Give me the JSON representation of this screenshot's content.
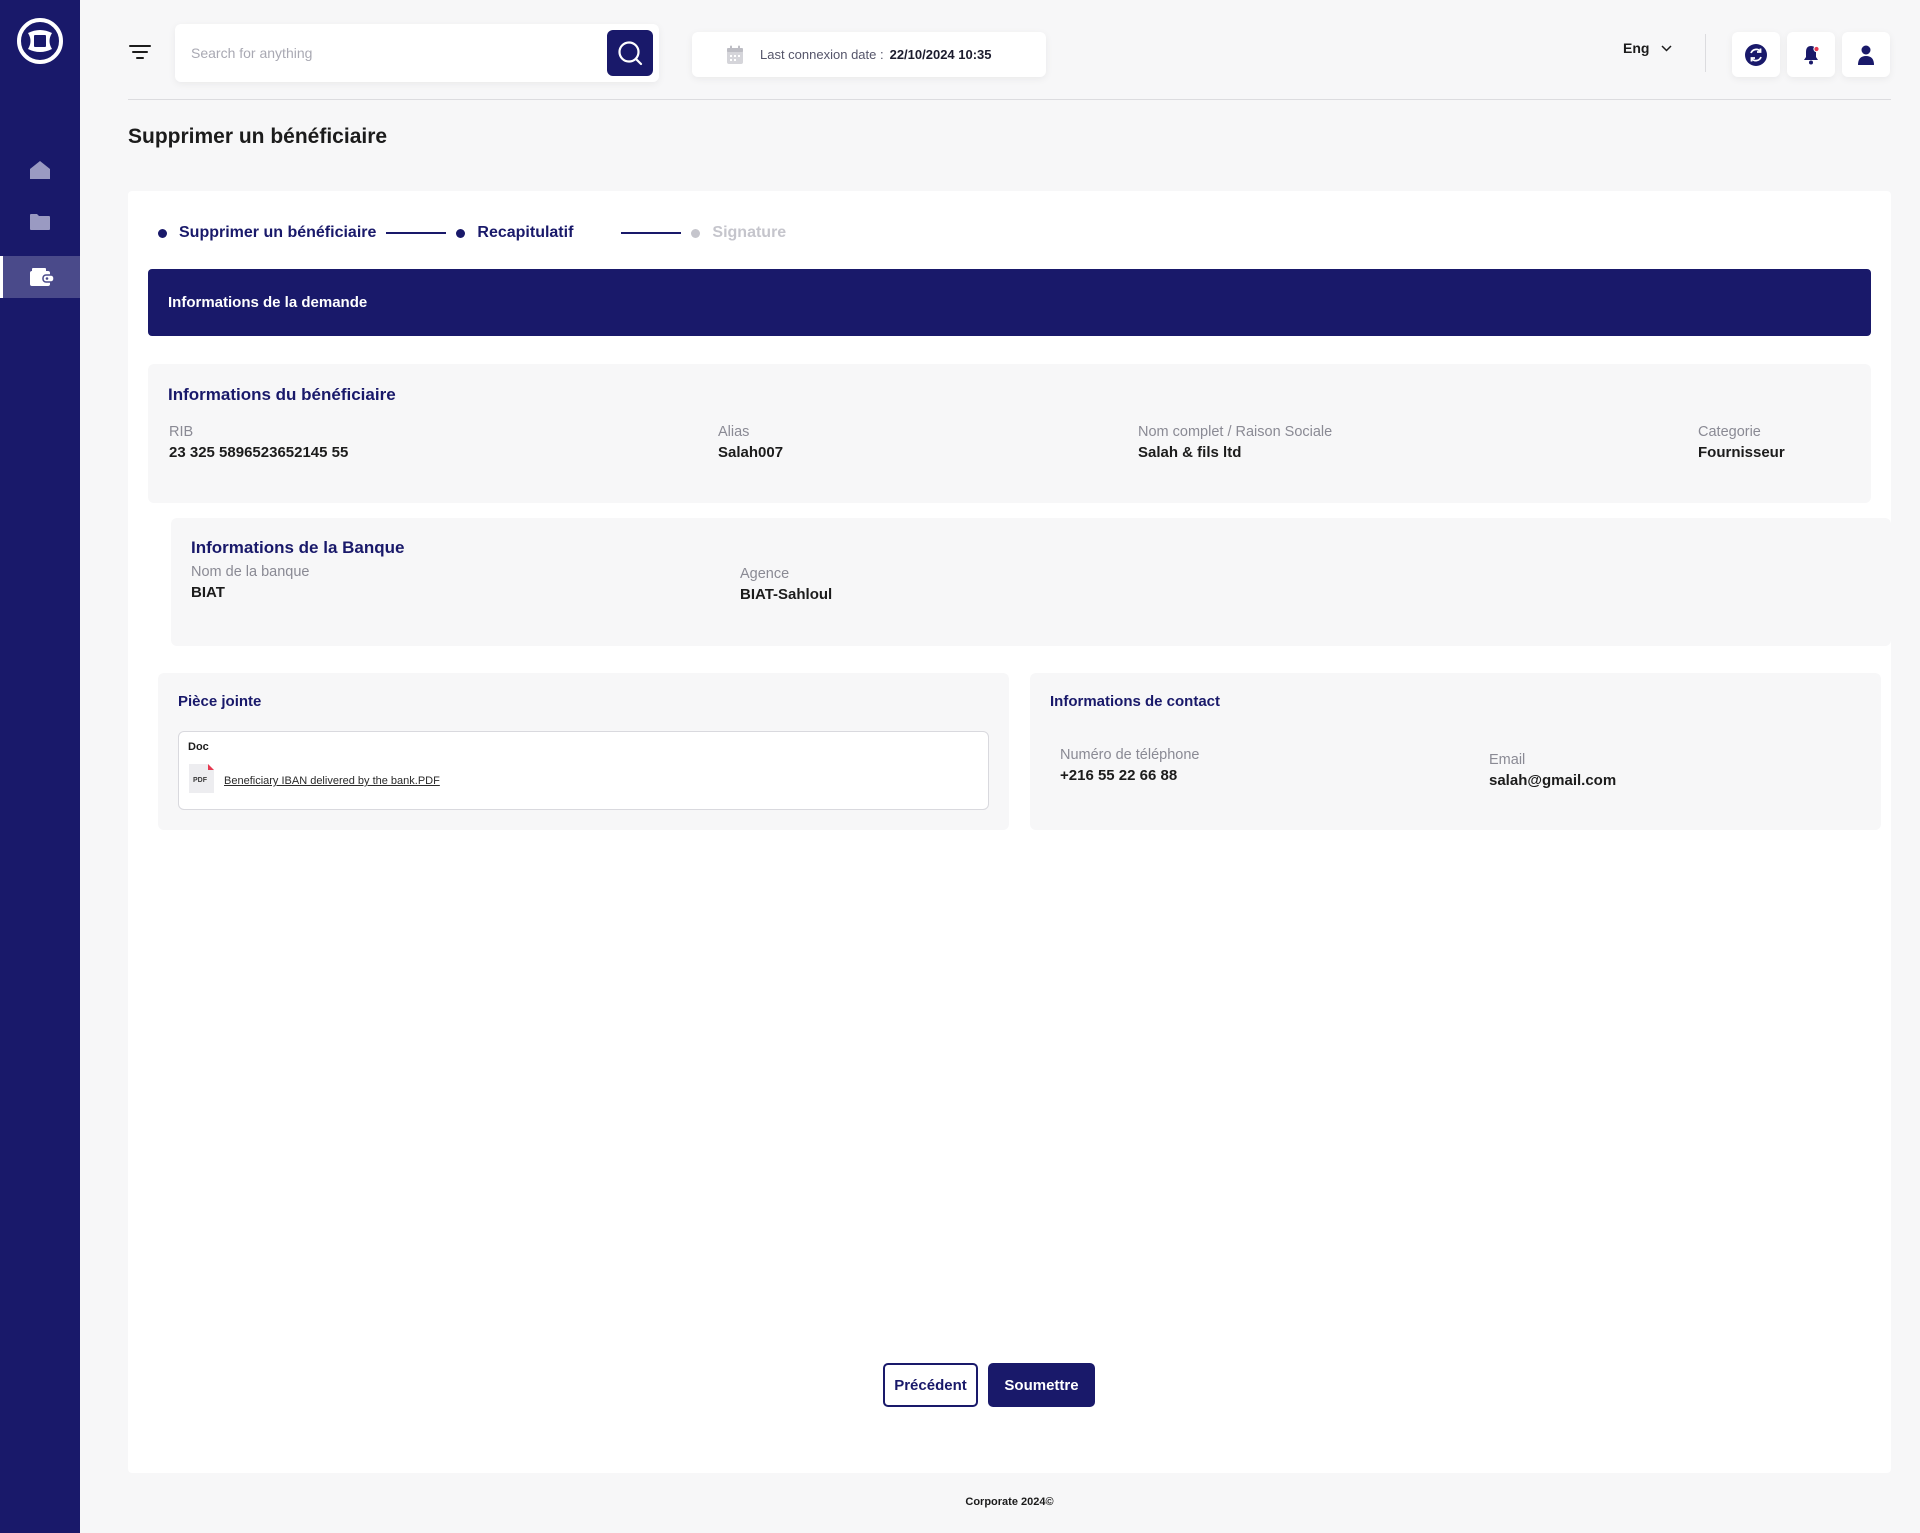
{
  "topbar": {
    "search_placeholder": "Search for anything",
    "last_connexion_label": "Last connexion date :",
    "last_connexion_value": "22/10/2024 10:35",
    "language": "Eng"
  },
  "page": {
    "title": "Supprimer un bénéficiaire"
  },
  "stepper": {
    "steps": [
      {
        "label": "Supprimer un bénéficiaire",
        "state": "active"
      },
      {
        "label": "Recapitulatif",
        "state": "active"
      },
      {
        "label": "Signature",
        "state": "inactive"
      }
    ]
  },
  "banner": {
    "title": "Informations de la demande"
  },
  "beneficiary": {
    "title": "Informations du bénéficiaire",
    "fields": [
      {
        "label": "RIB",
        "value": "23 325 5896523652145 55"
      },
      {
        "label": "Alias",
        "value": "Salah007"
      },
      {
        "label": "Nom complet / Raison Sociale",
        "value": "Salah & fils ltd"
      },
      {
        "label": "Categorie",
        "value": "Fournisseur"
      }
    ]
  },
  "bank": {
    "title": "Informations de la Banque",
    "fields": [
      {
        "label": "Nom de la banque",
        "value": "BIAT"
      },
      {
        "label": "Agence",
        "value": "BIAT-Sahloul"
      }
    ]
  },
  "attachment": {
    "title": "Pièce jointe",
    "doc_label": "Doc",
    "file_type": "PDF",
    "file_name": "Beneficiary IBAN delivered by the bank.PDF"
  },
  "contact": {
    "title": "Informations de contact",
    "fields": [
      {
        "label": "Numéro de téléphone",
        "value": "+216 55 22 66 88"
      },
      {
        "label": "Email",
        "value": "salah@gmail.com"
      }
    ]
  },
  "actions": {
    "previous_label": "Précédent",
    "submit_label": "Soumettre"
  },
  "footer": {
    "text": "Corporate 2024©"
  },
  "colors": {
    "primary": "#19196a",
    "background": "#f7f7f8",
    "inactive": "#c5c5cc",
    "notification_dot": "#e53950"
  },
  "icons": {
    "logo": "app-logo-icon",
    "nav": [
      "home-icon",
      "folder-icon",
      "wallet-icon"
    ],
    "topbar": [
      "menu-icon",
      "search-icon",
      "calendar-icon",
      "chevron-down-icon",
      "sync-icon",
      "bell-icon",
      "user-icon"
    ],
    "attachment": "pdf-file-icon"
  }
}
